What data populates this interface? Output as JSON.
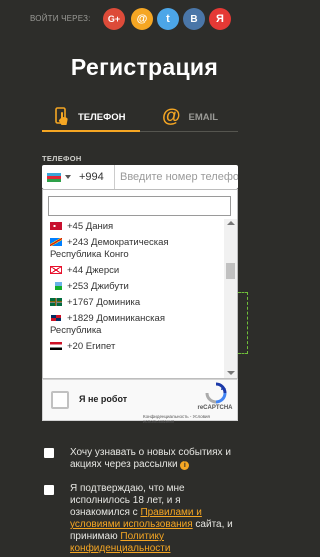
{
  "social": {
    "login_via": "ВОЙТИ ЧЕРЕЗ:",
    "buttons": [
      {
        "name": "google-plus",
        "glyph": "G+",
        "color": "#dd4b39"
      },
      {
        "name": "mail",
        "glyph": "@",
        "color": "#f5a623"
      },
      {
        "name": "twitter",
        "glyph": "t",
        "color": "#4ca6e8"
      },
      {
        "name": "vk",
        "glyph": "В",
        "color": "#4a76a8"
      },
      {
        "name": "yandex",
        "glyph": "Я",
        "color": "#e53935"
      }
    ]
  },
  "title": "Регистрация",
  "tabs": {
    "phone": "ТЕЛЕФОН",
    "email": "EMAIL",
    "email_icon": "@"
  },
  "phone": {
    "label": "ТЕЛЕФОН",
    "dial_code": "+994",
    "placeholder": "Введите номер телефона"
  },
  "dropdown": {
    "countries": [
      {
        "text": "+45 Дания",
        "flag": "dk"
      },
      {
        "text": "+243 Демократическая Республика Конго",
        "flag": "cd"
      },
      {
        "text": "+44 Джерси",
        "flag": "je"
      },
      {
        "text": "+253 Джибути",
        "flag": "dj"
      },
      {
        "text": "+1767 Доминика",
        "flag": "dm"
      },
      {
        "text": "+1829 Доминиканская Республика",
        "flag": "do"
      },
      {
        "text": "+20 Египет",
        "flag": "eg"
      }
    ]
  },
  "recaptcha": {
    "label": "Я не робот",
    "brand": "reCAPTCHA",
    "privacy": "Конфиденциальность - Условия использования"
  },
  "consents": {
    "newsletter": "Хочу узнавать о новых событиях и акциях через рассылки",
    "info_icon": "i",
    "age_prefix": "Я подтверждаю, что мне исполнилось 18 лет, и я ознакомился с ",
    "rules_link": "Правилами и условиями использования",
    "age_mid": " сайта, и принимаю ",
    "privacy_link": "Политику конфиденциальности"
  },
  "colors": {
    "accent": "#f5a623",
    "background": "#2d2d2a"
  }
}
